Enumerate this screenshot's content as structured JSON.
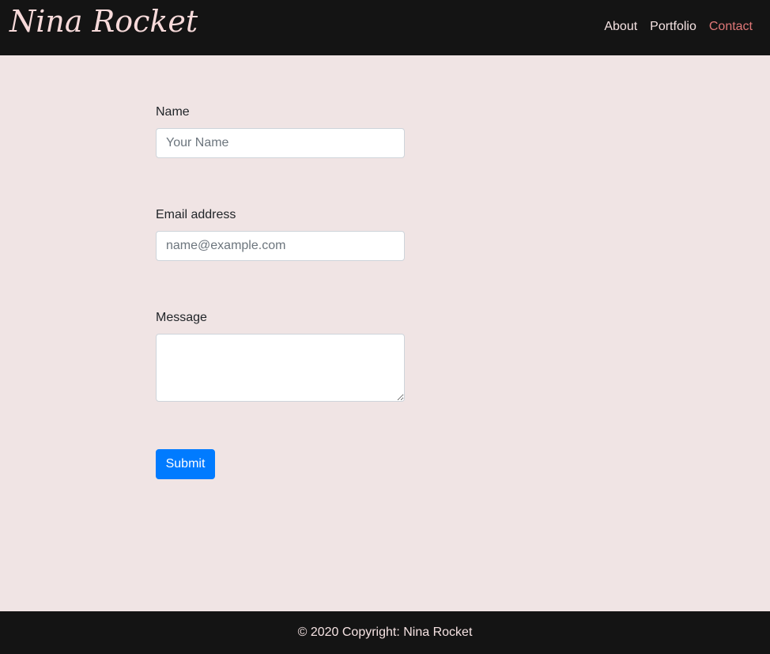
{
  "navbar": {
    "brand": "Nina Rocket",
    "links": [
      {
        "label": "About",
        "active": false
      },
      {
        "label": "Portfolio",
        "active": false
      },
      {
        "label": "Contact",
        "active": true
      }
    ],
    "colors": {
      "background": "#141414",
      "link": "#f6e3e3",
      "active_link": "#e07878",
      "brand": "#f7dada"
    }
  },
  "form": {
    "name": {
      "label": "Name",
      "placeholder": "Your Name",
      "value": ""
    },
    "email": {
      "label": "Email address",
      "placeholder": "name@example.com",
      "value": ""
    },
    "message": {
      "label": "Message",
      "value": ""
    },
    "submit_label": "Submit",
    "submit_color": "#007bff"
  },
  "footer": {
    "text": "© 2020 Copyright: Nina Rocket"
  },
  "page": {
    "background": "#f0e4e4"
  }
}
